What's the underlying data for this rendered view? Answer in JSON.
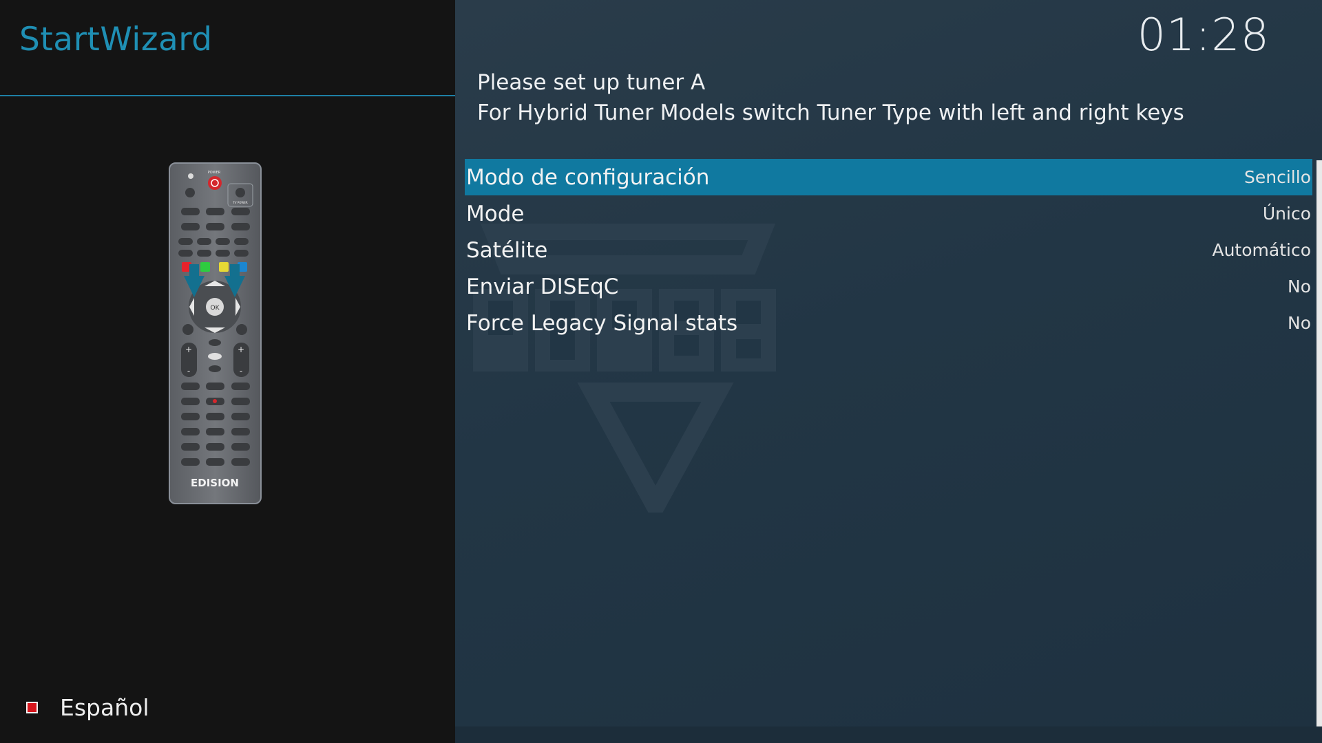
{
  "wizard": {
    "title": "StartWizard"
  },
  "clock": {
    "time": "01:28"
  },
  "instructions": {
    "line1": "Please set up tuner A",
    "line2": "For Hybrid Tuner Models switch Tuner Type with left and right keys"
  },
  "settings": [
    {
      "label": "Modo de configuración",
      "value": "Sencillo",
      "selected": true
    },
    {
      "label": "Mode",
      "value": "Único",
      "selected": false
    },
    {
      "label": "Satélite",
      "value": "Automático",
      "selected": false
    },
    {
      "label": "Enviar DISEqC",
      "value": "No",
      "selected": false
    },
    {
      "label": "Force Legacy Signal stats",
      "value": "No",
      "selected": false
    }
  ],
  "language": {
    "label": "Español",
    "flag_color": "#d7161d"
  },
  "remote": {
    "brand": "EDISION",
    "power_label": "POWER",
    "tv_power_label": "TV POWER",
    "ok_label": "OK",
    "color_keys": [
      "#e8232b",
      "#2ecc40",
      "#e7d935",
      "#1b86d0"
    ],
    "arrow_color": "#13708f"
  },
  "colors": {
    "accent": "#1f8fb4",
    "selection": "#1079a0",
    "panel_left": "#141414",
    "panel_right": "#223645"
  }
}
